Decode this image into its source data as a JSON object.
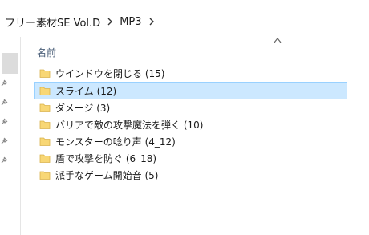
{
  "address_bar": {
    "crumbs": [
      "フリー素材SE Vol.D",
      "MP3"
    ]
  },
  "columns": {
    "name_header": "名前"
  },
  "files": [
    {
      "name": "ウインドウを閉じる (15)",
      "selected": false
    },
    {
      "name": "スライム (12)",
      "selected": true
    },
    {
      "name": "ダメージ (3)",
      "selected": false
    },
    {
      "name": "バリアで敵の攻撃魔法を弾く (10)",
      "selected": false
    },
    {
      "name": "モンスターの唸り声 (4_12)",
      "selected": false
    },
    {
      "name": "盾で攻撃を防ぐ (6_18)",
      "selected": false
    },
    {
      "name": "派手なゲーム開始音 (5)",
      "selected": false
    }
  ],
  "colors": {
    "selection_fill": "#cce8ff",
    "selection_border": "#99d1ff",
    "folder_yellow": "#f8d775",
    "header_text": "#4c607a"
  },
  "icons": {
    "crumb_separator": "chevron-right-icon",
    "sort": "sort-ascending-icon",
    "folder": "folder-icon",
    "pin": "pin-icon"
  }
}
